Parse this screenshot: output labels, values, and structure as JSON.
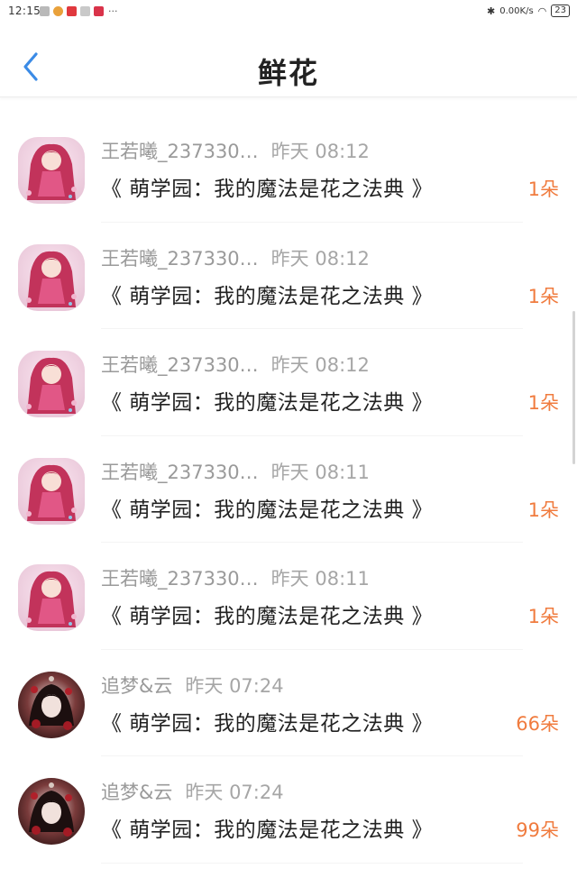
{
  "status_bar": {
    "time": "12:15",
    "more": "···",
    "speed": "0.00K/s",
    "battery": "23"
  },
  "header": {
    "title": "鲜花"
  },
  "items": [
    {
      "name": "王若曦_237330…",
      "time": "昨天 08:12",
      "book": "《 萌学园：我的魔法是花之法典 》",
      "qty": "1朵",
      "avatar": "pink"
    },
    {
      "name": "王若曦_237330…",
      "time": "昨天 08:12",
      "book": "《 萌学园：我的魔法是花之法典 》",
      "qty": "1朵",
      "avatar": "pink"
    },
    {
      "name": "王若曦_237330…",
      "time": "昨天 08:12",
      "book": "《 萌学园：我的魔法是花之法典 》",
      "qty": "1朵",
      "avatar": "pink"
    },
    {
      "name": "王若曦_237330…",
      "time": "昨天 08:11",
      "book": "《 萌学园：我的魔法是花之法典 》",
      "qty": "1朵",
      "avatar": "pink"
    },
    {
      "name": "王若曦_237330…",
      "time": "昨天 08:11",
      "book": "《 萌学园：我的魔法是花之法典 》",
      "qty": "1朵",
      "avatar": "pink"
    },
    {
      "name": "追梦&云",
      "time": "昨天 07:24",
      "book": "《 萌学园：我的魔法是花之法典 》",
      "qty": "66朵",
      "avatar": "dark"
    },
    {
      "name": "追梦&云",
      "time": "昨天 07:24",
      "book": "《 萌学园：我的魔法是花之法典 》",
      "qty": "99朵",
      "avatar": "dark"
    }
  ],
  "colors": {
    "accent_back": "#3b8be6",
    "quantity": "#f07b3e"
  }
}
